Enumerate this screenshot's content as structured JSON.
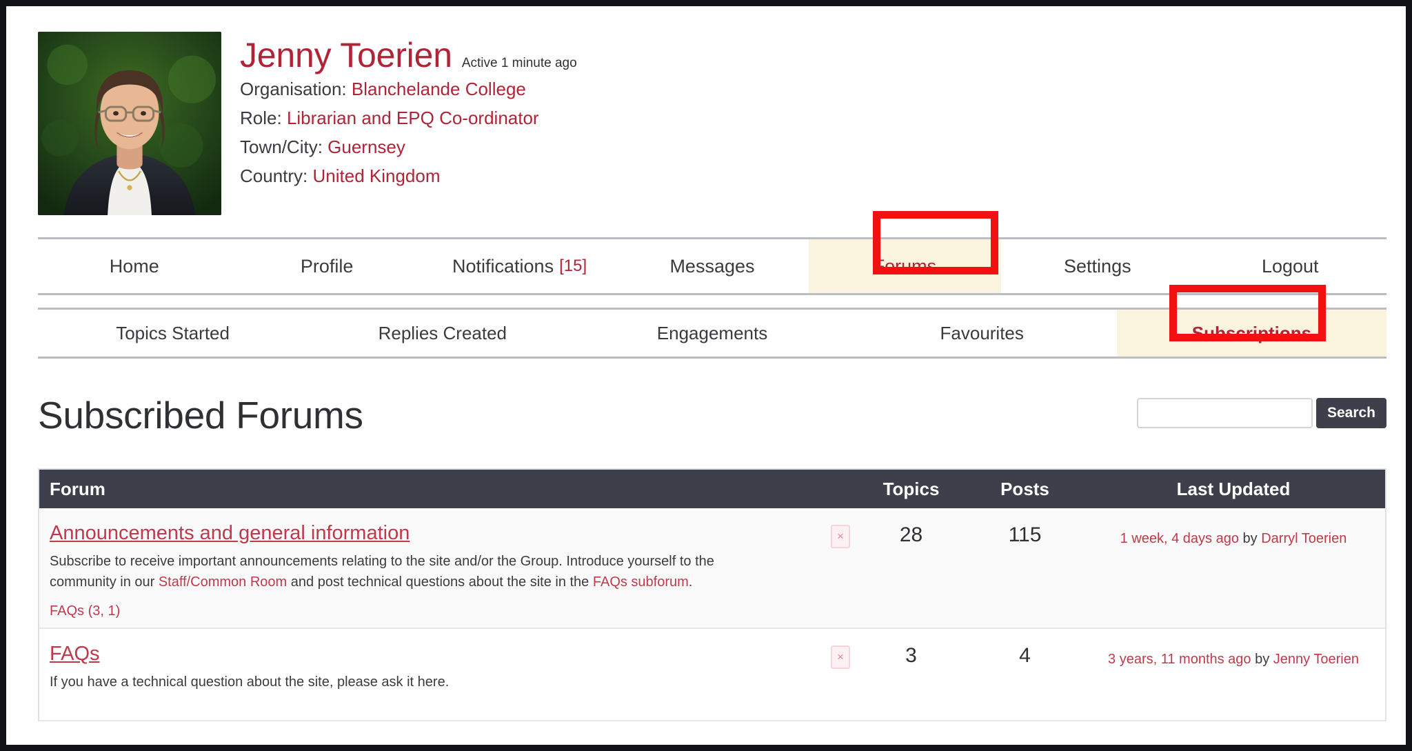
{
  "profile": {
    "avatar_alt": "user-avatar-photo",
    "name": "Jenny Toerien",
    "active_status": "Active 1 minute ago",
    "fields": [
      {
        "label": "Organisation:",
        "value": "Blanchelande College"
      },
      {
        "label": "Role:",
        "value": "Librarian and EPQ Co-ordinator"
      },
      {
        "label": "Town/City:",
        "value": "Guernsey"
      },
      {
        "label": "Country:",
        "value": "United Kingdom"
      }
    ]
  },
  "nav": {
    "items": [
      {
        "label": "Home",
        "count": "",
        "active": false
      },
      {
        "label": "Profile",
        "count": "",
        "active": false
      },
      {
        "label": "Notifications",
        "count": "[15]",
        "active": false
      },
      {
        "label": "Messages",
        "count": "",
        "active": false
      },
      {
        "label": "Forums",
        "count": "",
        "active": true
      },
      {
        "label": "Settings",
        "count": "",
        "active": false
      },
      {
        "label": "Logout",
        "count": "",
        "active": false
      }
    ]
  },
  "subnav": {
    "items": [
      {
        "label": "Topics Started",
        "active": false
      },
      {
        "label": "Replies Created",
        "active": false
      },
      {
        "label": "Engagements",
        "active": false
      },
      {
        "label": "Favourites",
        "active": false
      },
      {
        "label": "Subscriptions",
        "active": true
      }
    ]
  },
  "annotations": {
    "forums_highlight": "Forums",
    "subscriptions_highlight": "Subscriptions"
  },
  "main": {
    "title": "Subscribed Forums",
    "search": {
      "value": "",
      "placeholder": "",
      "button_label": "Search"
    },
    "table": {
      "headers": {
        "forum": "Forum",
        "topics": "Topics",
        "posts": "Posts",
        "updated": "Last Updated"
      },
      "rows": [
        {
          "title": "Announcements and general information",
          "desc_part1": "Subscribe to receive important announcements relating to the site and/or the Group. Introduce yourself to the community in our ",
          "desc_link1": "Staff/Common Room",
          "desc_part2": " and post technical questions about the site in the ",
          "desc_link2": "FAQs subforum",
          "desc_part3": ".",
          "subforum_link": "FAQs (3, 1)",
          "unsubscribe_label": "×",
          "topics": "28",
          "posts": "115",
          "updated_time": "1 week, 4 days ago",
          "updated_by_prefix": " by ",
          "updated_author": "Darryl Toerien"
        },
        {
          "title": "FAQs",
          "desc_part1": "If you have a technical question about the site, please ask it here.",
          "desc_link1": "",
          "desc_part2": "",
          "desc_link2": "",
          "desc_part3": "",
          "subforum_link": "",
          "unsubscribe_label": "×",
          "topics": "3",
          "posts": "4",
          "updated_time": "3 years, 11 months ago",
          "updated_by_prefix": " by ",
          "updated_author": "Jenny Toerien"
        }
      ]
    }
  },
  "colors": {
    "brand_red": "#b02437",
    "link_red": "#c0394b",
    "annotation_red": "#f21111",
    "highlight_bg": "#faf4df",
    "table_header_bg": "#3d3f4a",
    "text_dark": "#2f3033"
  }
}
